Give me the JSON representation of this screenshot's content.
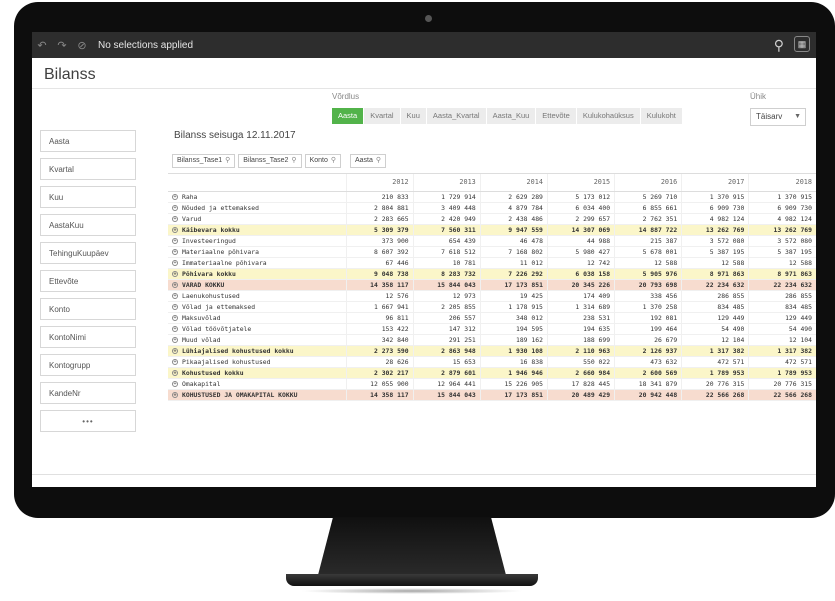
{
  "toolbar": {
    "selection_text": "No selections applied"
  },
  "sheet": {
    "title": "Bilanss"
  },
  "filters": [
    "Aasta",
    "Kvartal",
    "Kuu",
    "AastaKuu",
    "TehinguKuupäev",
    "Ettevõte",
    "Konto",
    "KontoNimi",
    "Kontogrupp",
    "KandeNr"
  ],
  "filters_more": "•••",
  "dimension": {
    "label": "Võrdlus",
    "options": [
      "Aasta",
      "Kvartal",
      "Kuu",
      "Aasta_Kvartal",
      "Aasta_Kuu",
      "Ettevõte",
      "Kulukohaüksus",
      "Kulukoht"
    ],
    "active": "Aasta"
  },
  "unit": {
    "label": "Ühik",
    "value": "Täisarv"
  },
  "table": {
    "title": "Bilanss seisuga 12.11.2017",
    "chips": [
      "Bilanss_Tase1",
      "Bilanss_Tase2",
      "Konto"
    ],
    "column_chip": "Aasta",
    "years": [
      "2012",
      "2013",
      "2014",
      "2015",
      "2016",
      "2017",
      "2018"
    ],
    "rows": [
      {
        "label": "Raha",
        "values": [
          "210 833",
          "1 729 914",
          "2 629 289",
          "5 173 012",
          "5 269 710",
          "1 370 915",
          "1 370 915"
        ],
        "hl": ""
      },
      {
        "label": "Nõuded ja ettemaksed",
        "values": [
          "2 804 881",
          "3 409 448",
          "4 879 784",
          "6 034 400",
          "6 855 661",
          "6 909 730",
          "6 909 730"
        ],
        "hl": ""
      },
      {
        "label": "Varud",
        "values": [
          "2 283 665",
          "2 420 949",
          "2 438 486",
          "2 299 657",
          "2 762 351",
          "4 982 124",
          "4 982 124"
        ],
        "hl": ""
      },
      {
        "label": "Käibevara kokku",
        "values": [
          "5 309 379",
          "7 560 311",
          "9 947 559",
          "14 307 069",
          "14 887 722",
          "13 262 769",
          "13 262 769"
        ],
        "hl": "y"
      },
      {
        "label": "Investeeringud",
        "values": [
          "373 900",
          "654 439",
          "46 478",
          "44 988",
          "215 387",
          "3 572 080",
          "3 572 080"
        ],
        "hl": ""
      },
      {
        "label": "Materiaalne põhivara",
        "values": [
          "8 607 392",
          "7 618 512",
          "7 168 802",
          "5 980 427",
          "5 678 001",
          "5 387 195",
          "5 387 195"
        ],
        "hl": ""
      },
      {
        "label": "Immateriaalne põhivara",
        "values": [
          "67 446",
          "10 781",
          "11 012",
          "12 742",
          "12 588",
          "12 588",
          "12 588"
        ],
        "hl": ""
      },
      {
        "label": "Põhivara kokku",
        "values": [
          "9 048 738",
          "8 283 732",
          "7 226 292",
          "6 038 158",
          "5 905 976",
          "8 971 863",
          "8 971 863"
        ],
        "hl": "y"
      },
      {
        "label": "VARAD KOKKU",
        "values": [
          "14 358 117",
          "15 844 043",
          "17 173 851",
          "20 345 226",
          "20 793 698",
          "22 234 632",
          "22 234 632"
        ],
        "hl": "r"
      },
      {
        "label": "Laenukohustused",
        "values": [
          "12 576",
          "12 973",
          "19 425",
          "174 409",
          "338 456",
          "286 855",
          "286 855"
        ],
        "hl": ""
      },
      {
        "label": "Võlad ja ettemaksed",
        "values": [
          "1 667 941",
          "2 205 855",
          "1 178 915",
          "1 314 689",
          "1 370 258",
          "834 485",
          "834 485"
        ],
        "hl": ""
      },
      {
        "label": "Maksuvõlad",
        "values": [
          "96 811",
          "206 557",
          "348 012",
          "238 531",
          "192 081",
          "129 449",
          "129 449"
        ],
        "hl": ""
      },
      {
        "label": "Võlad töövõtjatele",
        "values": [
          "153 422",
          "147 312",
          "194 595",
          "194 635",
          "199 464",
          "54 490",
          "54 490"
        ],
        "hl": ""
      },
      {
        "label": "Muud võlad",
        "values": [
          "342 840",
          "291 251",
          "189 162",
          "188 699",
          "26 679",
          "12 104",
          "12 104"
        ],
        "hl": ""
      },
      {
        "label": "Lühiajalised kohustused kokku",
        "values": [
          "2 273 590",
          "2 863 948",
          "1 930 108",
          "2 110 963",
          "2 126 937",
          "1 317 382",
          "1 317 382"
        ],
        "hl": "y"
      },
      {
        "label": "Pikaajalised kohustused",
        "values": [
          "28 626",
          "15 653",
          "16 838",
          "550 022",
          "473 632",
          "472 571",
          "472 571"
        ],
        "hl": ""
      },
      {
        "label": "Kohustused kokku",
        "values": [
          "2 302 217",
          "2 879 601",
          "1 946 946",
          "2 660 984",
          "2 600 569",
          "1 789 953",
          "1 789 953"
        ],
        "hl": "y"
      },
      {
        "label": "Omakapital",
        "values": [
          "12 055 900",
          "12 964 441",
          "15 226 905",
          "17 828 445",
          "18 341 879",
          "20 776 315",
          "20 776 315"
        ],
        "hl": ""
      },
      {
        "label": "KOHUSTUSED JA OMAKAPITAL KOKKU",
        "values": [
          "14 358 117",
          "15 844 043",
          "17 173 851",
          "20 489 429",
          "20 942 448",
          "22 566 268",
          "22 566 268"
        ],
        "hl": "r"
      }
    ]
  },
  "colors": {
    "accent": "#52b34a",
    "highlight_yellow": "#fbf6c9",
    "highlight_red": "#f7dccf"
  }
}
